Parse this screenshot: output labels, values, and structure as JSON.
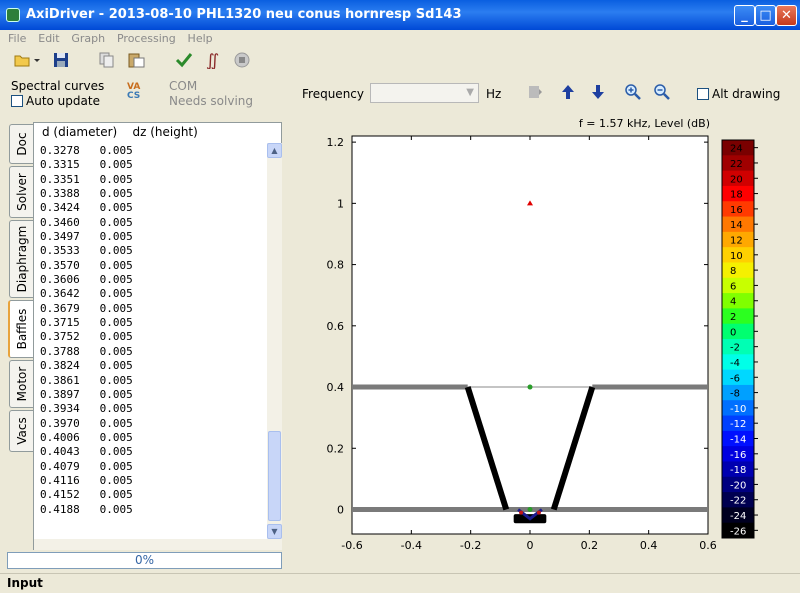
{
  "window": {
    "title": "AxiDriver - 2013-08-10 PHL1320 neu conus hornresp Sd143"
  },
  "menu": [
    "File",
    "Edit",
    "Graph",
    "Processing",
    "Help"
  ],
  "left": {
    "spectral_label": "Spectral curves",
    "auto_update_label": "Auto update",
    "vacs_icon_text": [
      "VA",
      "CS"
    ],
    "com_label": "COM",
    "com_status": "Needs solving"
  },
  "controls": {
    "frequency_label": "Frequency",
    "frequency_value": "",
    "hz_label": "Hz",
    "alt_drawing_label": "Alt drawing"
  },
  "tabs": [
    "Doc",
    "Solver",
    "Diaphragm",
    "Baffles",
    "Motor",
    "Vacs"
  ],
  "active_tab": "Baffles",
  "table": {
    "col_d": "d (diameter)",
    "col_dz": "dz (height)",
    "rows": [
      [
        "0.3278",
        "0.005"
      ],
      [
        "0.3315",
        "0.005"
      ],
      [
        "0.3351",
        "0.005"
      ],
      [
        "0.3388",
        "0.005"
      ],
      [
        "0.3424",
        "0.005"
      ],
      [
        "0.3460",
        "0.005"
      ],
      [
        "0.3497",
        "0.005"
      ],
      [
        "0.3533",
        "0.005"
      ],
      [
        "0.3570",
        "0.005"
      ],
      [
        "0.3606",
        "0.005"
      ],
      [
        "0.3642",
        "0.005"
      ],
      [
        "0.3679",
        "0.005"
      ],
      [
        "0.3715",
        "0.005"
      ],
      [
        "0.3752",
        "0.005"
      ],
      [
        "0.3788",
        "0.005"
      ],
      [
        "0.3824",
        "0.005"
      ],
      [
        "0.3861",
        "0.005"
      ],
      [
        "0.3897",
        "0.005"
      ],
      [
        "0.3934",
        "0.005"
      ],
      [
        "0.3970",
        "0.005"
      ],
      [
        "0.4006",
        "0.005"
      ],
      [
        "0.4043",
        "0.005"
      ],
      [
        "0.4079",
        "0.005"
      ],
      [
        "0.4116",
        "0.005"
      ],
      [
        "0.4152",
        "0.005"
      ],
      [
        "0.4188",
        "0.005"
      ]
    ]
  },
  "progress": {
    "label": "0%",
    "value": 0
  },
  "status": "Input",
  "plot": {
    "title": "f = 1.57 kHz, Level  (dB)",
    "x_ticks": [
      "-0.6",
      "-0.4",
      "-0.2",
      "0",
      "0.2",
      "0.4",
      "0.6"
    ],
    "y_ticks": [
      "0",
      "0.2",
      "0.4",
      "0.6",
      "0.8",
      "1",
      "1.2"
    ],
    "xlim": [
      -0.6,
      0.6
    ],
    "ylim": [
      -0.08,
      1.22
    ],
    "colorbar_ticks": [
      "24",
      "22",
      "20",
      "18",
      "16",
      "14",
      "12",
      "10",
      "8",
      "6",
      "4",
      "2",
      "0",
      "-2",
      "-4",
      "-6",
      "-8",
      "-10",
      "-12",
      "-14",
      "-16",
      "-18",
      "-20",
      "-22",
      "-24",
      "-26"
    ],
    "colors": {
      "baffle": "#7a7a7a",
      "horn": "#000000",
      "marker_red": "#e00000",
      "marker_green": "#2a9d2a",
      "axis_center": "#b0b0b0"
    }
  }
}
